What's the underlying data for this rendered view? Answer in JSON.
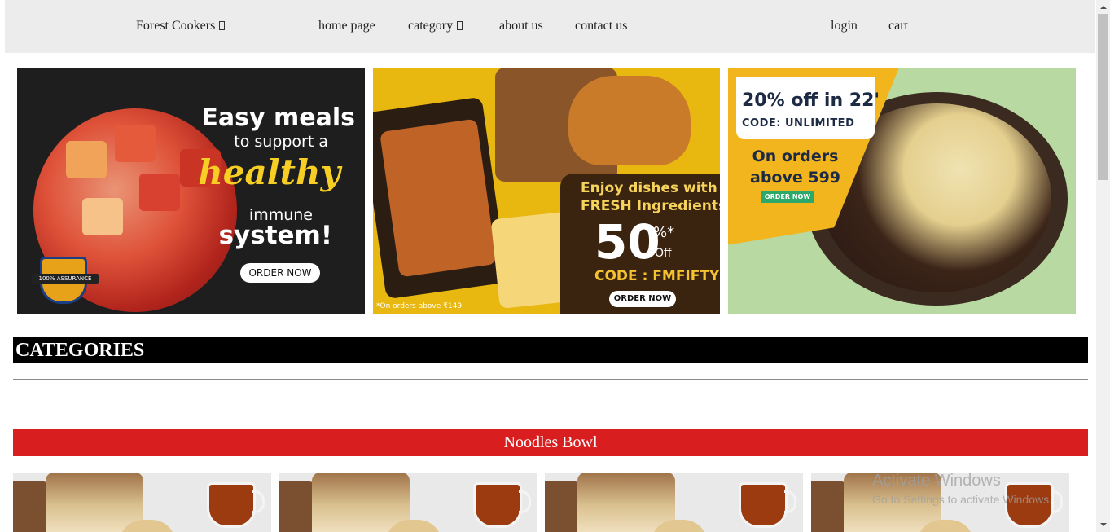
{
  "navbar": {
    "brand": "Forest Cookers",
    "links": [
      "home page",
      "category",
      "about us",
      "contact us"
    ],
    "right_links": [
      "login",
      "cart"
    ]
  },
  "banners": [
    {
      "line1": "Easy meals",
      "line2": "to support a",
      "line3": "healthy",
      "line4": "immune",
      "line5": "system!",
      "button": "ORDER NOW",
      "badge": "100% ASSURANCE"
    },
    {
      "line1": "Enjoy dishes with",
      "line2": "FRESH Ingredients",
      "discount": "50",
      "percent": "%*",
      "off": "Off",
      "code": "CODE : FMFIFTY",
      "button": "ORDER NOW",
      "note": "*On orders above ₹149"
    },
    {
      "headline": "20% off in 22'",
      "code": "CODE: UNLIMITED",
      "line1": "On orders",
      "line2": "above 599",
      "button": "ORDER NOW"
    }
  ],
  "categories_title": "CATEGORIES",
  "section_title": "Noodles Bowl",
  "product_cards": [
    {
      "name": "product-card-1"
    },
    {
      "name": "product-card-2"
    },
    {
      "name": "product-card-3"
    },
    {
      "name": "product-card-4"
    }
  ],
  "watermark": {
    "line1": "Activate Windows",
    "line2": "Go to Settings to activate Windows."
  },
  "colors": {
    "navbar_bg": "#ececec",
    "categories_bg": "#000000",
    "section_bg": "#d81e1e",
    "accent_yellow": "#f7cf24"
  }
}
